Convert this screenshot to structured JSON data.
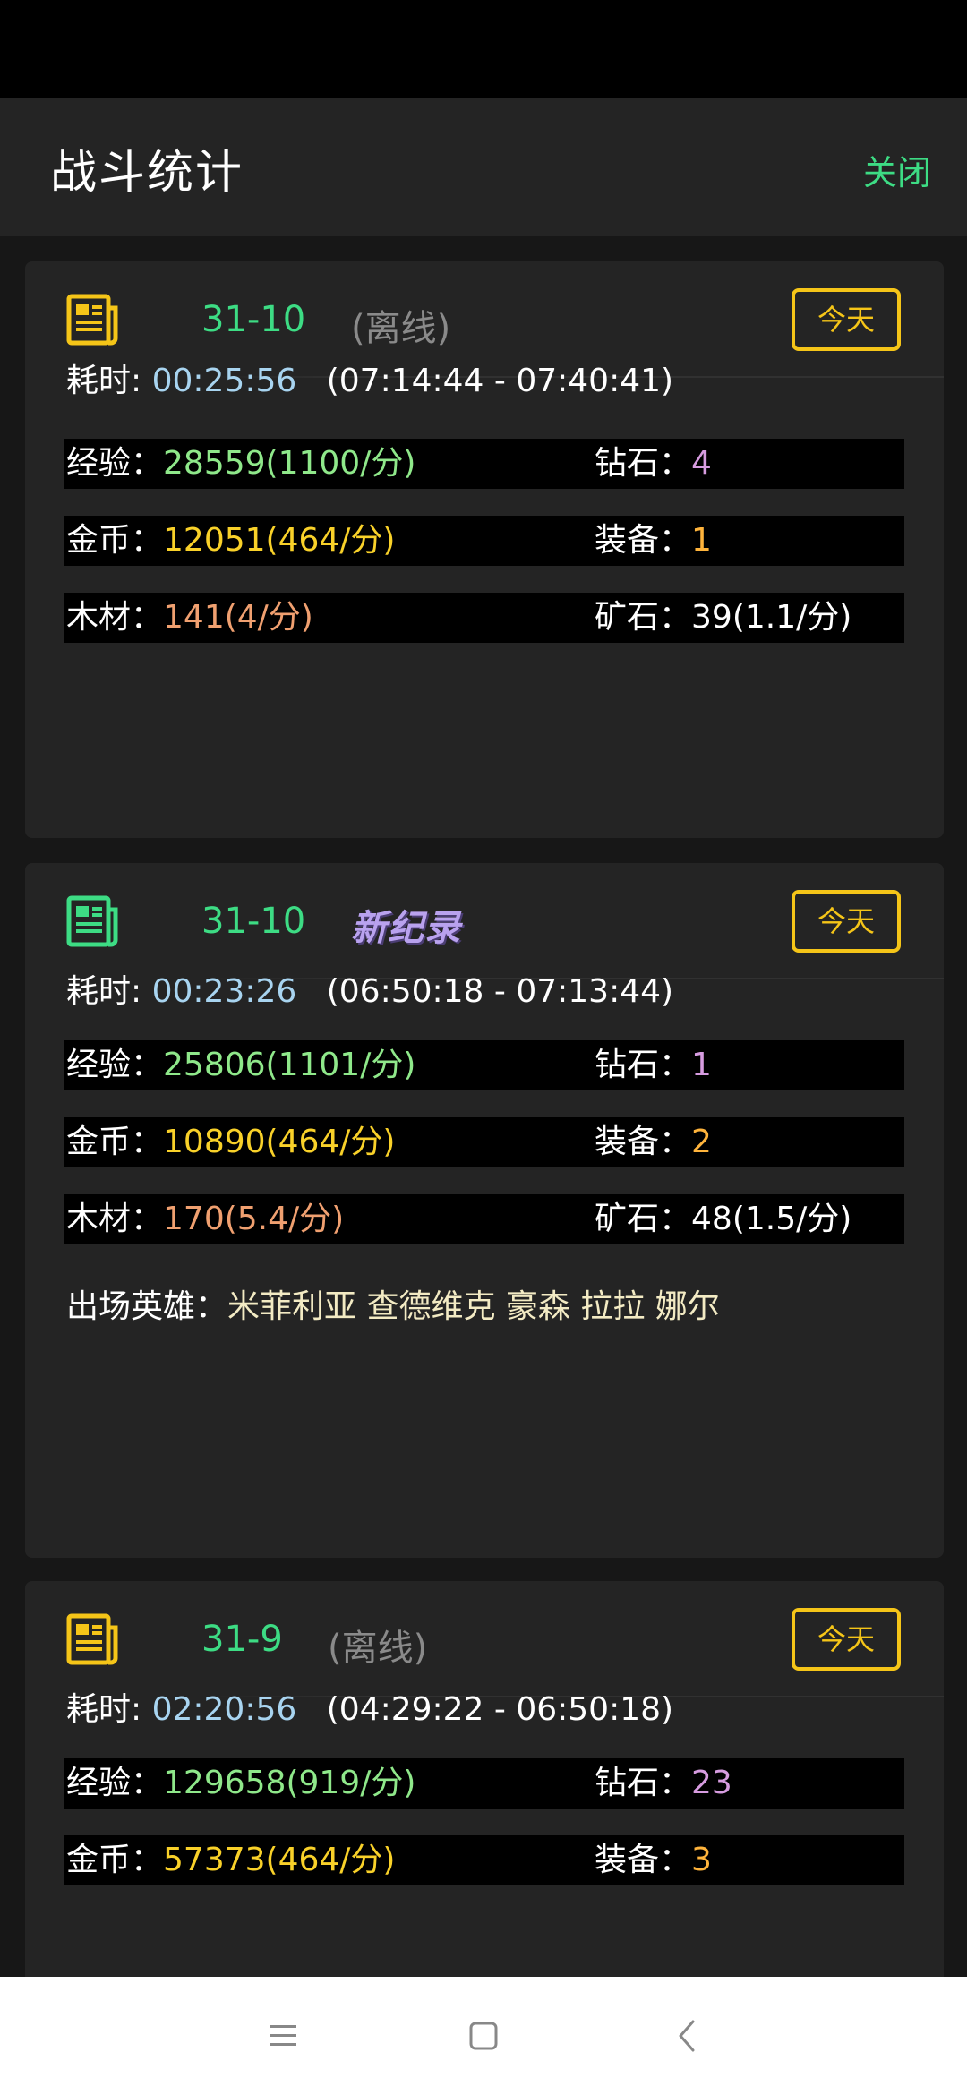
{
  "header": {
    "title": "战斗统计",
    "close_label": "关闭"
  },
  "labels": {
    "time": "耗时:",
    "exp": "经验：",
    "diamond": "钻石：",
    "gold": "金币：",
    "equip": "装备：",
    "wood": "木材：",
    "ore": "矿石：",
    "heroes": "出场英雄："
  },
  "records": [
    {
      "stage": "31-10",
      "tag": "(离线)",
      "tag_type": "offline",
      "today_label": "今天",
      "icon_color": "#f5c518",
      "duration": "00:25:56",
      "range": "(07:14:44 - 07:40:41)",
      "exp": "28559(1100/分)",
      "diamond": "4",
      "gold": "12051(464/分)",
      "equip": "1",
      "wood": "141(4/分)",
      "ore": "39(1.1/分)"
    },
    {
      "stage": "31-10",
      "tag": "新纪录",
      "tag_type": "record",
      "today_label": "今天",
      "icon_color": "#3ddc84",
      "duration": "00:23:26",
      "range": "(06:50:18 - 07:13:44)",
      "exp": "25806(1101/分)",
      "diamond": "1",
      "gold": "10890(464/分)",
      "equip": "2",
      "wood": "170(5.4/分)",
      "ore": "48(1.5/分)",
      "heroes": "米菲利亚 查德维克 豪森 拉拉 娜尔"
    },
    {
      "stage": "31-9",
      "tag": "(离线)",
      "tag_type": "offline",
      "today_label": "今天",
      "icon_color": "#f5c518",
      "duration": "02:20:56",
      "range": "(04:29:22 - 06:50:18)",
      "exp": "129658(919/分)",
      "diamond": "23",
      "gold": "57373(464/分)",
      "equip": "3"
    }
  ],
  "nav": {
    "menu_icon": "menu-icon",
    "home_icon": "home-icon",
    "back_icon": "back-icon"
  }
}
